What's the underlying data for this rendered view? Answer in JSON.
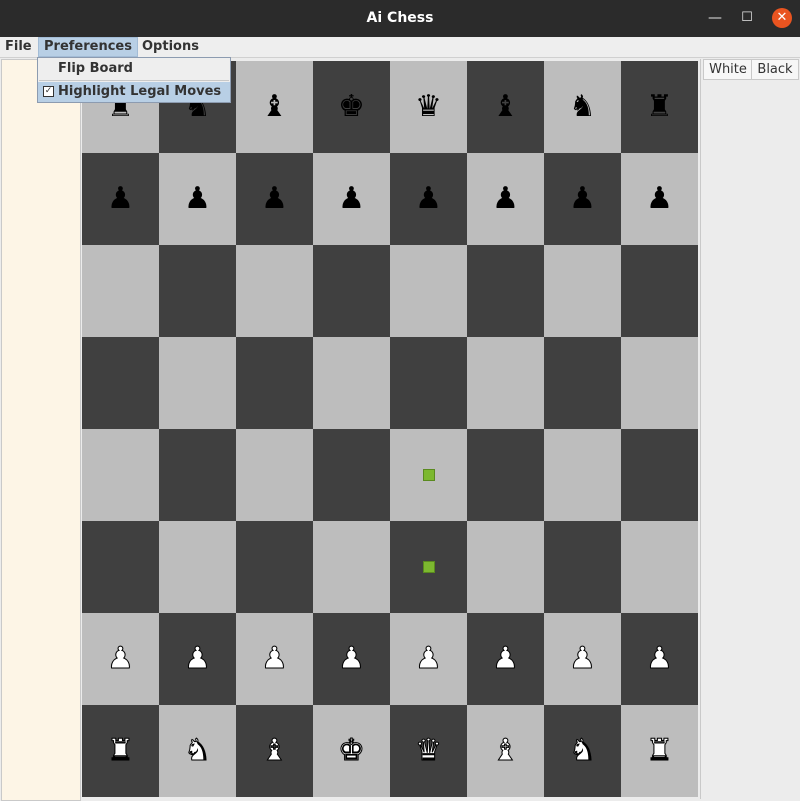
{
  "window": {
    "title": "Ai Chess",
    "min_glyph": "—",
    "max_glyph": "☐",
    "close_glyph": "✕"
  },
  "menubar": {
    "file": "File",
    "preferences": "Preferences",
    "options": "Options"
  },
  "preferences_menu": {
    "flip_board": "Flip Board",
    "highlight_legal_moves": "Highlight Legal Moves",
    "highlight_checked": true,
    "check_glyph": "✓"
  },
  "side_panel": {
    "tabs": [
      "White",
      "Black"
    ]
  },
  "board": {
    "light_color": "#bdbdbd",
    "dark_color": "#404040",
    "ranks": [
      [
        {
          "c": "b",
          "g": "♜",
          "n": "rook"
        },
        {
          "c": "b",
          "g": "♞",
          "n": "knight"
        },
        {
          "c": "b",
          "g": "♝",
          "n": "bishop"
        },
        {
          "c": "b",
          "g": "♚",
          "n": "king"
        },
        {
          "c": "b",
          "g": "♛",
          "n": "queen"
        },
        {
          "c": "b",
          "g": "♝",
          "n": "bishop"
        },
        {
          "c": "b",
          "g": "♞",
          "n": "knight"
        },
        {
          "c": "b",
          "g": "♜",
          "n": "rook"
        }
      ],
      [
        {
          "c": "b",
          "g": "♟",
          "n": "pawn"
        },
        {
          "c": "b",
          "g": "♟",
          "n": "pawn"
        },
        {
          "c": "b",
          "g": "♟",
          "n": "pawn"
        },
        {
          "c": "b",
          "g": "♟",
          "n": "pawn"
        },
        {
          "c": "b",
          "g": "♟",
          "n": "pawn"
        },
        {
          "c": "b",
          "g": "♟",
          "n": "pawn"
        },
        {
          "c": "b",
          "g": "♟",
          "n": "pawn"
        },
        {
          "c": "b",
          "g": "♟",
          "n": "pawn"
        }
      ],
      [
        null,
        null,
        null,
        null,
        null,
        null,
        null,
        null
      ],
      [
        null,
        null,
        null,
        null,
        null,
        null,
        null,
        null
      ],
      [
        null,
        null,
        null,
        null,
        null,
        null,
        null,
        null
      ],
      [
        null,
        null,
        null,
        null,
        null,
        null,
        null,
        null
      ],
      [
        {
          "c": "w",
          "g": "♟",
          "n": "pawn"
        },
        {
          "c": "w",
          "g": "♟",
          "n": "pawn"
        },
        {
          "c": "w",
          "g": "♟",
          "n": "pawn"
        },
        {
          "c": "w",
          "g": "♟",
          "n": "pawn"
        },
        {
          "c": "w",
          "g": "♟",
          "n": "pawn"
        },
        {
          "c": "w",
          "g": "♟",
          "n": "pawn"
        },
        {
          "c": "w",
          "g": "♟",
          "n": "pawn"
        },
        {
          "c": "w",
          "g": "♟",
          "n": "pawn"
        }
      ],
      [
        {
          "c": "w",
          "g": "♜",
          "n": "rook"
        },
        {
          "c": "w",
          "g": "♞",
          "n": "knight"
        },
        {
          "c": "w",
          "g": "♝",
          "n": "bishop"
        },
        {
          "c": "w",
          "g": "♚",
          "n": "king"
        },
        {
          "c": "w",
          "g": "♛",
          "n": "queen"
        },
        {
          "c": "w",
          "g": "♝",
          "n": "bishop"
        },
        {
          "c": "w",
          "g": "♞",
          "n": "knight"
        },
        {
          "c": "w",
          "g": "♜",
          "n": "rook"
        }
      ]
    ],
    "legal_move_highlights": [
      [
        4,
        4
      ],
      [
        5,
        4
      ]
    ],
    "highlight_color": "#7cb82f"
  }
}
